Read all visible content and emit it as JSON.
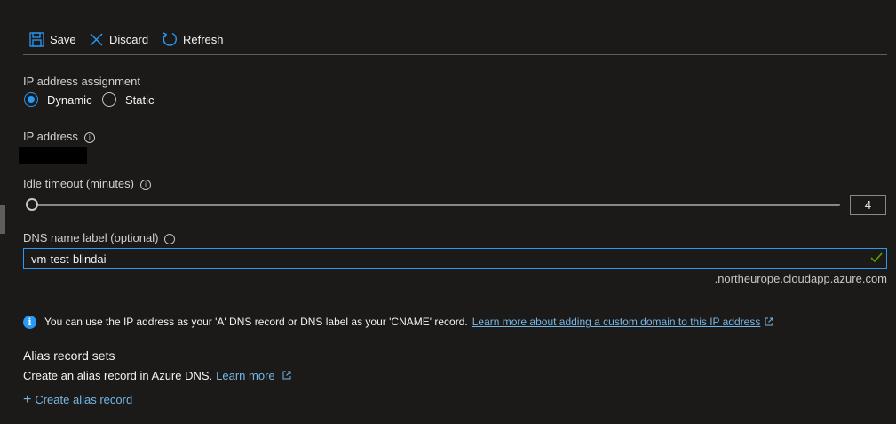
{
  "toolbar": {
    "save_label": "Save",
    "discard_label": "Discard",
    "refresh_label": "Refresh"
  },
  "ip_assignment": {
    "label": "IP address assignment",
    "options": [
      "Dynamic",
      "Static"
    ],
    "selected": "Dynamic"
  },
  "ip_address": {
    "label": "IP address",
    "value_redacted": true
  },
  "idle_timeout": {
    "label": "Idle timeout (minutes)",
    "value": "4"
  },
  "dns_label": {
    "label": "DNS name label (optional)",
    "value": "vm-test-blindai",
    "suffix": ".northeurope.cloudapp.azure.com"
  },
  "info_banner": {
    "text": "You can use the IP address as your 'A' DNS record or DNS label as your 'CNAME' record.",
    "link_text": "Learn more about adding a custom domain to this IP address"
  },
  "alias": {
    "title": "Alias record sets",
    "description": "Create an alias record in Azure DNS.",
    "learn_more": "Learn more",
    "create_label": "Create alias record"
  },
  "colors": {
    "background": "#1b1a19",
    "accent": "#2899f5",
    "link": "#75b6e7",
    "valid_check": "#57a300"
  }
}
